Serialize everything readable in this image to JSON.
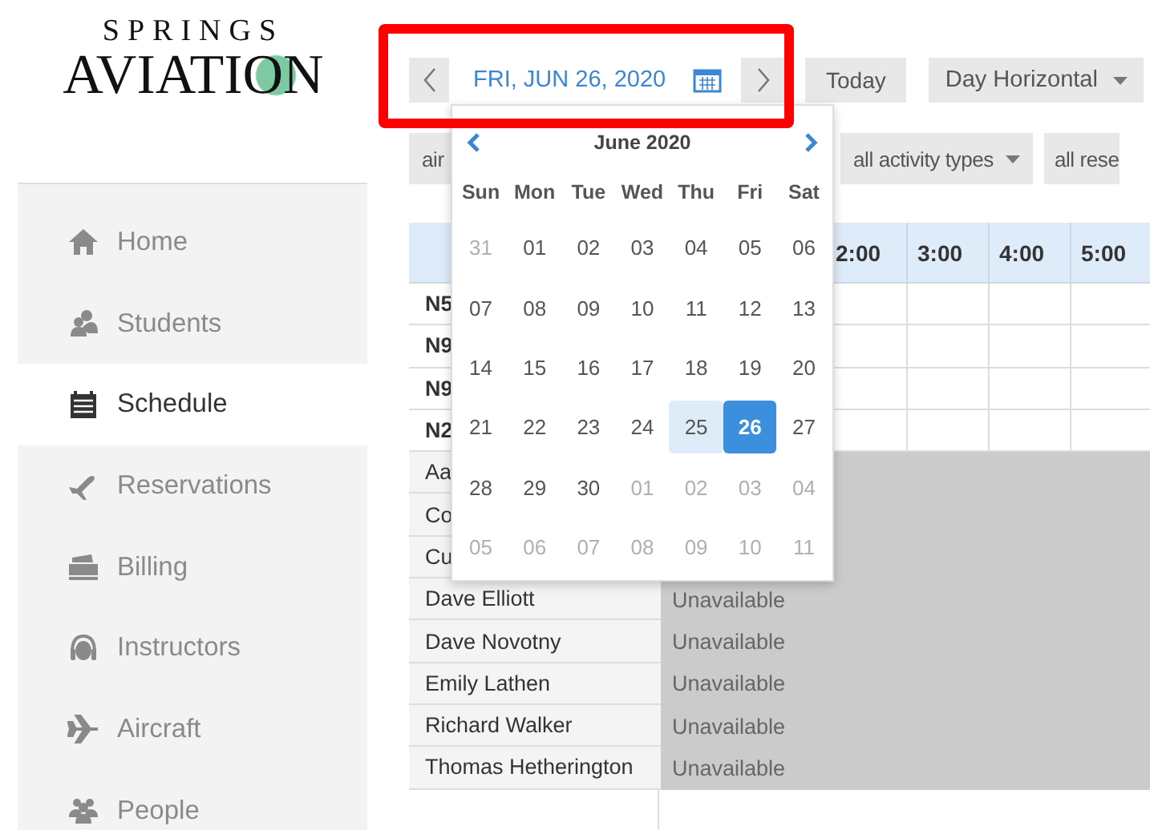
{
  "logo": {
    "top": "SPRINGS",
    "bottom": "AVIATION"
  },
  "sidebar": {
    "items": [
      {
        "label": "Home",
        "selected": false
      },
      {
        "label": "Students",
        "selected": false
      },
      {
        "label": "Schedule",
        "selected": true
      },
      {
        "label": "Reservations",
        "selected": false
      },
      {
        "label": "Billing",
        "selected": false
      },
      {
        "label": "Instructors",
        "selected": false
      },
      {
        "label": "Aircraft",
        "selected": false
      },
      {
        "label": "People",
        "selected": false
      }
    ]
  },
  "toolbar": {
    "date": "FRI, JUN 26, 2020",
    "today_button": "Today",
    "view_select": "Day Horizontal"
  },
  "filters": [
    {
      "label": "air"
    },
    {
      "label": "all activity types",
      "caret": true
    },
    {
      "label": "all rese"
    }
  ],
  "table": {
    "hour_columns": [
      "2:00",
      "3:00",
      "4:00",
      "5:00"
    ],
    "rows": [
      {
        "label": "N5",
        "kind": "aircraft"
      },
      {
        "label": "N9",
        "kind": "aircraft"
      },
      {
        "label": "N9",
        "kind": "aircraft"
      },
      {
        "label": "N2",
        "kind": "aircraft"
      },
      {
        "label": "Aa",
        "kind": "person"
      },
      {
        "label": "Co",
        "kind": "person"
      },
      {
        "label": "Cu",
        "kind": "person"
      },
      {
        "label": "Dave Elliott",
        "kind": "person",
        "note": "Unavailable"
      },
      {
        "label": "Dave Novotny",
        "kind": "person",
        "note": "Unavailable"
      },
      {
        "label": "Emily Lathen",
        "kind": "person",
        "note": "Unavailable"
      },
      {
        "label": "Richard Walker",
        "kind": "person",
        "note": "Unavailable"
      },
      {
        "label": "Thomas Hetherington",
        "kind": "person",
        "note": "Unavailable"
      }
    ]
  },
  "datepicker": {
    "month": "June 2020",
    "weekdays": [
      "Sun",
      "Mon",
      "Tue",
      "Wed",
      "Thu",
      "Fri",
      "Sat"
    ],
    "weeks": [
      [
        {
          "day": "31",
          "muted": true,
          "highlighted": false,
          "selected": false
        },
        {
          "day": "01",
          "muted": false,
          "highlighted": false,
          "selected": false
        },
        {
          "day": "02",
          "muted": false,
          "highlighted": false,
          "selected": false
        },
        {
          "day": "03",
          "muted": false,
          "highlighted": false,
          "selected": false
        },
        {
          "day": "04",
          "muted": false,
          "highlighted": false,
          "selected": false
        },
        {
          "day": "05",
          "muted": false,
          "highlighted": false,
          "selected": false
        },
        {
          "day": "06",
          "muted": false,
          "highlighted": false,
          "selected": false
        }
      ],
      [
        {
          "day": "07",
          "muted": false,
          "highlighted": false,
          "selected": false
        },
        {
          "day": "08",
          "muted": false,
          "highlighted": false,
          "selected": false
        },
        {
          "day": "09",
          "muted": false,
          "highlighted": false,
          "selected": false
        },
        {
          "day": "10",
          "muted": false,
          "highlighted": false,
          "selected": false
        },
        {
          "day": "11",
          "muted": false,
          "highlighted": false,
          "selected": false
        },
        {
          "day": "12",
          "muted": false,
          "highlighted": false,
          "selected": false
        },
        {
          "day": "13",
          "muted": false,
          "highlighted": false,
          "selected": false
        }
      ],
      [
        {
          "day": "14",
          "muted": false,
          "highlighted": false,
          "selected": false
        },
        {
          "day": "15",
          "muted": false,
          "highlighted": false,
          "selected": false
        },
        {
          "day": "16",
          "muted": false,
          "highlighted": false,
          "selected": false
        },
        {
          "day": "17",
          "muted": false,
          "highlighted": false,
          "selected": false
        },
        {
          "day": "18",
          "muted": false,
          "highlighted": false,
          "selected": false
        },
        {
          "day": "19",
          "muted": false,
          "highlighted": false,
          "selected": false
        },
        {
          "day": "20",
          "muted": false,
          "highlighted": false,
          "selected": false
        }
      ],
      [
        {
          "day": "21",
          "muted": false,
          "highlighted": false,
          "selected": false
        },
        {
          "day": "22",
          "muted": false,
          "highlighted": false,
          "selected": false
        },
        {
          "day": "23",
          "muted": false,
          "highlighted": false,
          "selected": false
        },
        {
          "day": "24",
          "muted": false,
          "highlighted": false,
          "selected": false
        },
        {
          "day": "25",
          "muted": false,
          "highlighted": true,
          "selected": false
        },
        {
          "day": "26",
          "muted": false,
          "highlighted": false,
          "selected": true
        },
        {
          "day": "27",
          "muted": false,
          "highlighted": false,
          "selected": false
        }
      ],
      [
        {
          "day": "28",
          "muted": false,
          "highlighted": false,
          "selected": false
        },
        {
          "day": "29",
          "muted": false,
          "highlighted": false,
          "selected": false
        },
        {
          "day": "30",
          "muted": false,
          "highlighted": false,
          "selected": false
        },
        {
          "day": "01",
          "muted": true,
          "highlighted": false,
          "selected": false
        },
        {
          "day": "02",
          "muted": true,
          "highlighted": false,
          "selected": false
        },
        {
          "day": "03",
          "muted": true,
          "highlighted": false,
          "selected": false
        },
        {
          "day": "04",
          "muted": true,
          "highlighted": false,
          "selected": false
        }
      ],
      [
        {
          "day": "05",
          "muted": true,
          "highlighted": false,
          "selected": false
        },
        {
          "day": "06",
          "muted": true,
          "highlighted": false,
          "selected": false
        },
        {
          "day": "07",
          "muted": true,
          "highlighted": false,
          "selected": false
        },
        {
          "day": "08",
          "muted": true,
          "highlighted": false,
          "selected": false
        },
        {
          "day": "09",
          "muted": true,
          "highlighted": false,
          "selected": false
        },
        {
          "day": "10",
          "muted": true,
          "highlighted": false,
          "selected": false
        },
        {
          "day": "11",
          "muted": true,
          "highlighted": false,
          "selected": false
        }
      ]
    ]
  }
}
